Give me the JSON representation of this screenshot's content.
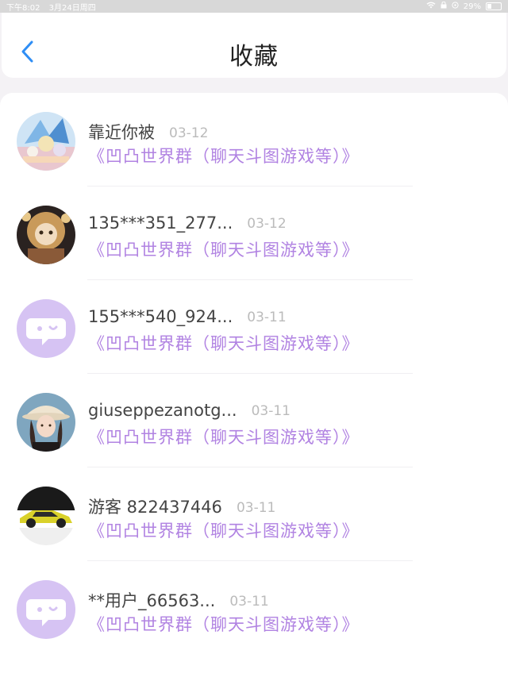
{
  "status_bar": {
    "time": "下午8:02",
    "date": "3月24日周四",
    "battery": "29%"
  },
  "header": {
    "title": "收藏"
  },
  "items": [
    {
      "name": "靠近你被",
      "date": "03-12",
      "group": "《凹凸世界群（聊天斗图游戏等）》",
      "avatar": "anime-pet-avatar"
    },
    {
      "name": "135***351_277...",
      "date": "03-12",
      "group": "《凹凸世界群（聊天斗图游戏等）》",
      "avatar": "anime-character-avatar"
    },
    {
      "name": "155***540_924...",
      "date": "03-11",
      "group": "《凹凸世界群（聊天斗图游戏等）》",
      "avatar": "default-chat-avatar"
    },
    {
      "name": "giuseppezanotg...",
      "date": "03-11",
      "group": "《凹凸世界群（聊天斗图游戏等）》",
      "avatar": "girl-hat-avatar"
    },
    {
      "name": "游客 822437446",
      "date": "03-11",
      "group": "《凹凸世界群（聊天斗图游戏等）》",
      "avatar": "yellow-car-avatar"
    },
    {
      "name": "**用户_66563...",
      "date": "03-11",
      "group": "《凹凸世界群（聊天斗图游戏等）》",
      "avatar": "default-chat-avatar"
    }
  ],
  "colors": {
    "accent": "#b183e2",
    "back": "#2f8ef5",
    "default_avatar": "#d6c3f3"
  }
}
